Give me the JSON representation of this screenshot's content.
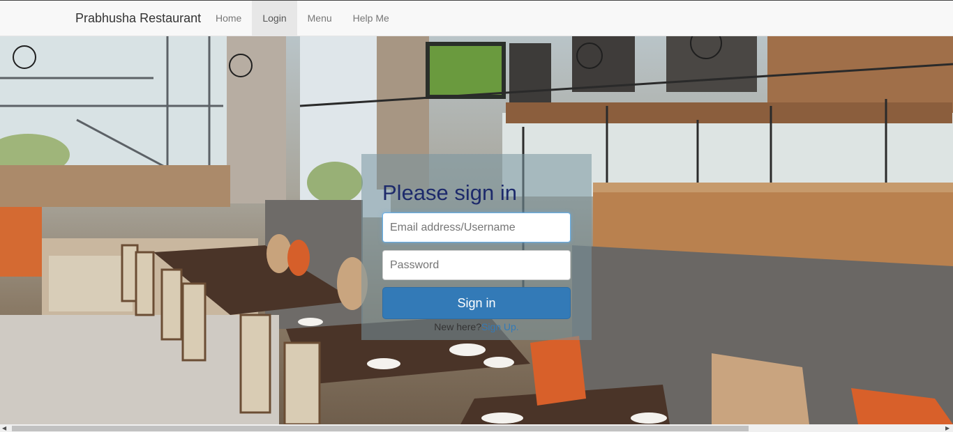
{
  "navbar": {
    "brand": "Prabhusha Restaurant",
    "items": [
      {
        "label": "Home"
      },
      {
        "label": "Login",
        "active": true
      },
      {
        "label": "Menu"
      },
      {
        "label": "Help Me"
      }
    ]
  },
  "signin": {
    "title": "Please sign in",
    "email_placeholder": "Email address/Username",
    "password_placeholder": "Password",
    "button_label": "Sign in",
    "new_here_text": "New here?",
    "signup_link": "Sign Up."
  },
  "colors": {
    "primary": "#337ab7",
    "title": "#1d2a6b",
    "navbar_bg": "#f8f8f8",
    "active_nav_bg": "#e7e7e7"
  }
}
